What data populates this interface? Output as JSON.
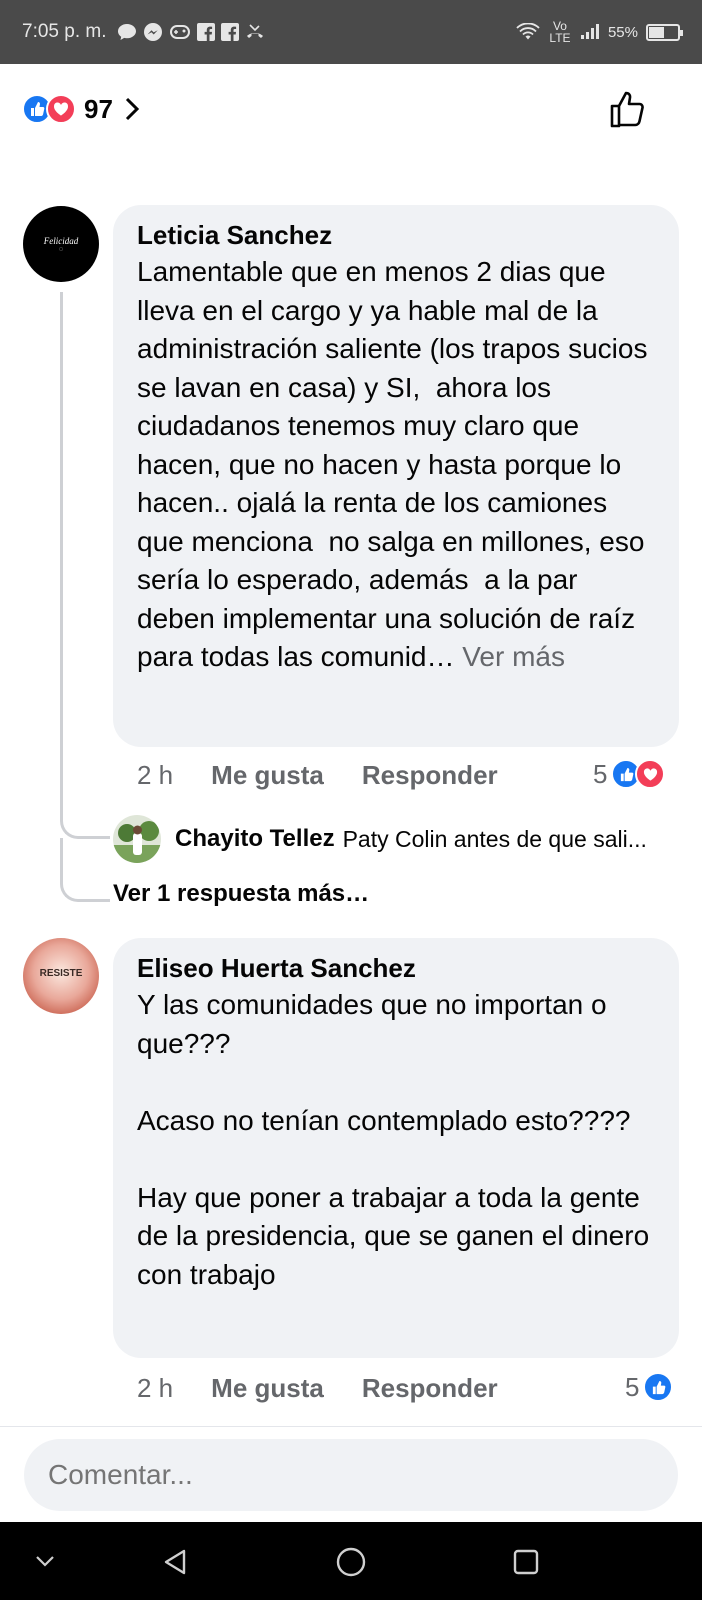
{
  "status_bar": {
    "time": "7:05 p. m.",
    "network": "Vo LTE",
    "battery": "55%",
    "battery_level": 0.55
  },
  "post_reactions": {
    "count": "97",
    "icons": [
      "like-icon",
      "love-icon"
    ]
  },
  "comments": [
    {
      "author": "Leticia Sanchez",
      "avatar_text": "Felicidad",
      "text": "Lamentable que en menos 2 dias que lleva en el cargo y ya hable mal de la administración saliente (los trapos sucios se lavan en casa) y SI,  ahora los ciudadanos tenemos muy claro que hacen, que no hacen y hasta porque lo hacen.. ojalá la renta de los camiones que menciona  no salga en millones, eso sería lo esperado, además  a la par deben implementar una solución de raíz  para todas las comunid…",
      "see_more": "Ver más",
      "time": "2 h",
      "like_label": "Me gusta",
      "reply_label": "Responder",
      "reaction_count": "5",
      "reply": {
        "author": "Chayito Tellez",
        "text": "Paty Colin antes de que sali..."
      },
      "more_replies": "Ver 1 respuesta más…"
    },
    {
      "author": "Eliseo Huerta Sanchez",
      "avatar_text": "RESISTE",
      "text": "Y las comunidades que no importan o que???\n\nAcaso no tenían contemplado esto????\n\nHay que poner a trabajar a toda la gente de la presidencia, que se ganen el dinero con trabajo",
      "time": "2 h",
      "like_label": "Me gusta",
      "reply_label": "Responder",
      "reaction_count": "5"
    }
  ],
  "composer": {
    "placeholder": "Comentar..."
  },
  "colors": {
    "like_blue": "#1877f2",
    "love_red": "#f33e58",
    "bubble_bg": "#f0f2f5",
    "secondary_text": "#65676b"
  }
}
